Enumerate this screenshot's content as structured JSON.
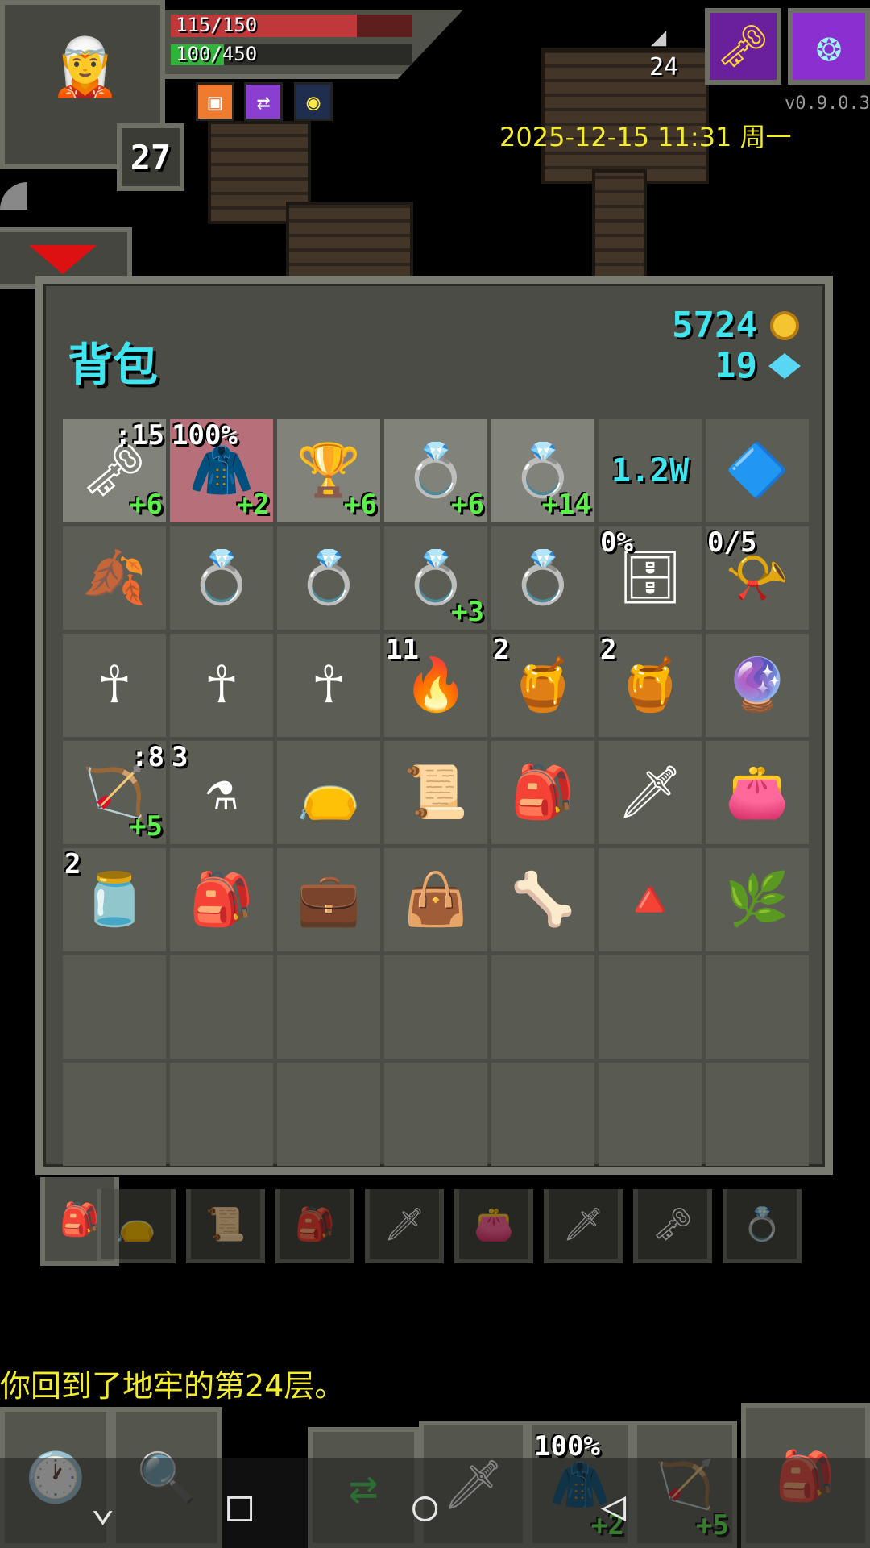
{
  "hud": {
    "hp": "115/150",
    "hp_fraction": 0.77,
    "exp": "100/450",
    "exp_fraction": 0.22,
    "level": "27",
    "depth": "24",
    "version": "v0.9.0.3",
    "datetime": "2025-12-15 11:31 周一",
    "buffs": [
      "buff-orange-icon",
      "buff-purple-arrows-icon",
      "buff-light-icon"
    ],
    "buff_glyphs": [
      "▣",
      "⇄",
      "◉"
    ],
    "journal_glyph": "🗝",
    "settings_glyph": "❂"
  },
  "backpack": {
    "title": "背包",
    "gold": "5724",
    "energy": "19",
    "rows": [
      [
        {
          "name": "key-weapon-icon",
          "glyph": "🗝",
          "tl": "",
          "tr": ":15",
          "br": "+6",
          "bg": "sel-lt"
        },
        {
          "name": "red-armor-icon",
          "glyph": "🧥",
          "tl": "100%",
          "tr": "",
          "br": "+2",
          "bg": "sel-red"
        },
        {
          "name": "chalice-icon",
          "glyph": "🏆",
          "tl": "",
          "tr": "",
          "br": "+6",
          "bg": "sel-lt"
        },
        {
          "name": "ring-icon",
          "glyph": "💍",
          "tl": "",
          "tr": "",
          "br": "+6",
          "bg": "sel-lt"
        },
        {
          "name": "ring-upgrade-icon",
          "glyph": "💍",
          "tl": "",
          "tr": "",
          "br": "+14",
          "bg": "sel-lt"
        },
        {
          "name": "counter-text",
          "glyph": "",
          "tl": "",
          "tr": "",
          "br": "",
          "mid": "1.2W",
          "bg": ""
        },
        {
          "name": "blue-artifact-icon",
          "glyph": "🔷",
          "tl": "",
          "tr": "",
          "br": "",
          "bg": ""
        }
      ],
      [
        {
          "name": "purple-leaf-icon",
          "glyph": "🍂",
          "tl": "",
          "tr": "",
          "br": "",
          "bg": ""
        },
        {
          "name": "ring-icon",
          "glyph": "💍",
          "tl": "",
          "tr": "",
          "br": "",
          "bg": ""
        },
        {
          "name": "ring-icon",
          "glyph": "💍",
          "tl": "",
          "tr": "",
          "br": "",
          "bg": ""
        },
        {
          "name": "ring-icon",
          "glyph": "💍",
          "tl": "",
          "tr": "",
          "br": "+3",
          "bg": ""
        },
        {
          "name": "ring-icon",
          "glyph": "💍",
          "tl": "",
          "tr": "",
          "br": "",
          "bg": ""
        },
        {
          "name": "cabinet-icon",
          "glyph": "🗄",
          "tl": "0%",
          "tr": "",
          "br": "",
          "bg": ""
        },
        {
          "name": "horn-icon",
          "glyph": "📯",
          "tl": "0/5",
          "tr": "",
          "br": "",
          "bg": ""
        }
      ],
      [
        {
          "name": "ankh-icon",
          "glyph": "☥",
          "tl": "",
          "tr": "",
          "br": "",
          "bg": ""
        },
        {
          "name": "ankh-icon",
          "glyph": "☥",
          "tl": "",
          "tr": "",
          "br": "",
          "bg": ""
        },
        {
          "name": "ankh-icon",
          "glyph": "☥",
          "tl": "",
          "tr": "",
          "br": "",
          "bg": ""
        },
        {
          "name": "torch-icon",
          "glyph": "🔥",
          "tl": "11",
          "tr": "",
          "br": "",
          "bg": ""
        },
        {
          "name": "pot-icon",
          "glyph": "🍯",
          "tl": "2",
          "tr": "",
          "br": "",
          "bg": ""
        },
        {
          "name": "gold-pot-icon",
          "glyph": "🍯",
          "tl": "2",
          "tr": "",
          "br": "",
          "bg": ""
        },
        {
          "name": "blue-wand-icon",
          "glyph": "🔮",
          "tl": "",
          "tr": "",
          "br": "",
          "bg": ""
        }
      ],
      [
        {
          "name": "bow-icon",
          "glyph": "🏹",
          "tl": "",
          "tr": ":8",
          "br": "+5",
          "bg": ""
        },
        {
          "name": "potion-icon",
          "glyph": "⚗",
          "tl": "3",
          "tr": "",
          "br": "",
          "bg": ""
        },
        {
          "name": "teal-bag-icon",
          "glyph": "👝",
          "tl": "",
          "tr": "",
          "br": "",
          "bg": ""
        },
        {
          "name": "scroll-bundle-icon",
          "glyph": "📜",
          "tl": "",
          "tr": "",
          "br": "",
          "bg": ""
        },
        {
          "name": "book-bag-icon",
          "glyph": "🎒",
          "tl": "",
          "tr": "",
          "br": "",
          "bg": ""
        },
        {
          "name": "purple-quiver-icon",
          "glyph": "🗡",
          "tl": "",
          "tr": "",
          "br": "",
          "bg": ""
        },
        {
          "name": "red-sack-icon",
          "glyph": "👛",
          "tl": "",
          "tr": "",
          "br": "",
          "bg": ""
        }
      ],
      [
        {
          "name": "jar-icon",
          "glyph": "🫙",
          "tl": "2",
          "tr": "",
          "br": "",
          "bg": ""
        },
        {
          "name": "backpack-icon",
          "glyph": "🎒",
          "tl": "",
          "tr": "",
          "br": "",
          "bg": ""
        },
        {
          "name": "chest-bag-icon",
          "glyph": "💼",
          "tl": "",
          "tr": "",
          "br": "",
          "bg": ""
        },
        {
          "name": "small-bag-icon",
          "glyph": "👜",
          "tl": "",
          "tr": "",
          "br": "",
          "bg": ""
        },
        {
          "name": "bones-icon",
          "glyph": "🦴",
          "tl": "",
          "tr": "",
          "br": "",
          "bg": ""
        },
        {
          "name": "crystal-icon",
          "glyph": "🔺",
          "tl": "",
          "tr": "",
          "br": "",
          "bg": ""
        },
        {
          "name": "green-herb-icon",
          "glyph": "🌿",
          "tl": "",
          "tr": "",
          "br": "",
          "bg": ""
        }
      ]
    ],
    "empty_rows": 2,
    "tabs": [
      "🎒",
      "👝",
      "📜",
      "🎒",
      "🗡",
      "👛",
      "🗡",
      "🗝",
      "💍"
    ]
  },
  "log": "你回到了地牢的第24层。",
  "toolbar": {
    "wait_glyph": "🕐",
    "search_glyph": "🔍",
    "swap_glyph": "⇄",
    "quick1_glyph": "🗡",
    "quick2_glyph": "🧥",
    "quick2_pct": "100%",
    "quick2_plus": "+2",
    "quick3_glyph": "🏹",
    "quick3_plus": "+5",
    "bag_glyph": "🎒"
  },
  "nav": {
    "menu": "⌄",
    "home": "□",
    "circle": "○",
    "back": "◁"
  }
}
